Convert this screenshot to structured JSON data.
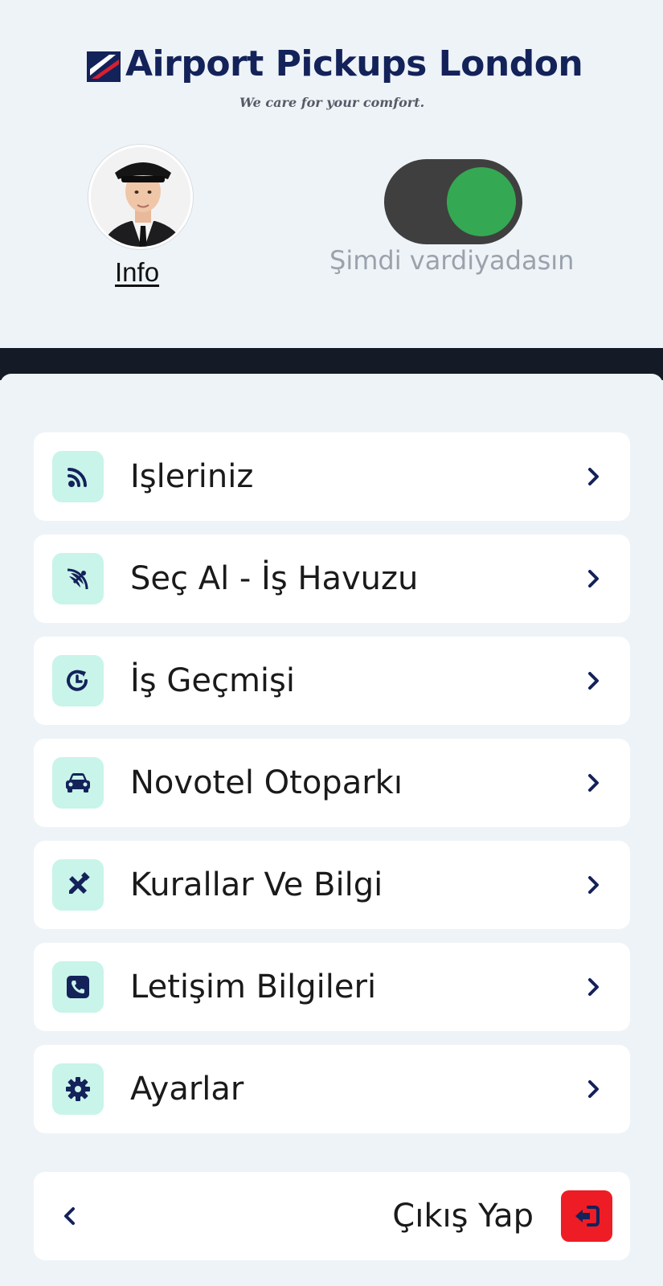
{
  "brand": {
    "name": "Airport Pickups London",
    "tagline": "We care for your comfort."
  },
  "profile": {
    "info_label": "Info",
    "shift_status": "Şimdi vardiyadasın",
    "shift_on": true
  },
  "menu": {
    "items": [
      {
        "label": "Işleriniz",
        "icon": "wifi-signal-icon"
      },
      {
        "label": "Seç Al - İş Havuzu",
        "icon": "satellite-dish-icon"
      },
      {
        "label": "İş Geçmişi",
        "icon": "history-clock-icon"
      },
      {
        "label": "Novotel Otoparkı",
        "icon": "car-icon"
      },
      {
        "label": "Kurallar Ve Bilgi",
        "icon": "ruler-pencil-icon"
      },
      {
        "label": "Letişim Bilgileri",
        "icon": "phone-square-icon"
      },
      {
        "label": "Ayarlar",
        "icon": "gear-icon"
      }
    ]
  },
  "logout": {
    "label": "Çıkış Yap",
    "icon": "sign-out-icon"
  },
  "colors": {
    "brand_navy": "#14225a",
    "toggle_on": "#35a853",
    "icon_bg": "#c9f4ea",
    "logout_red": "#ee1c24"
  }
}
